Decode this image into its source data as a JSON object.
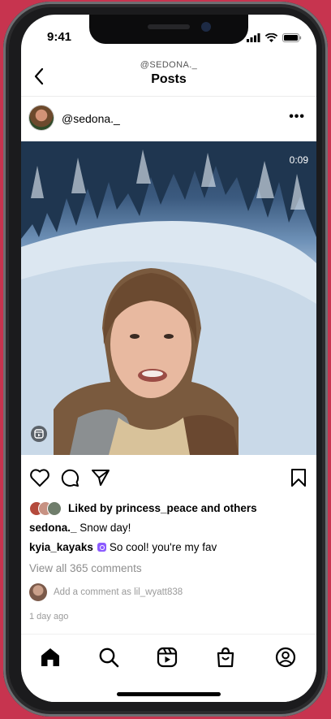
{
  "status_bar": {
    "time": "9:41"
  },
  "header": {
    "handle": "@SEDONA._",
    "title": "Posts"
  },
  "post": {
    "username": "@sedona._",
    "video_duration": "0:09",
    "liked_by": "Liked by princess_peace and others",
    "caption": {
      "user": "sedona._",
      "text": "Snow day!"
    },
    "comment": {
      "user": "kyia_kayaks",
      "text": "So cool! you're my fav"
    },
    "view_all_comments": "View all 365 comments",
    "add_comment_placeholder": "Add a comment as lil_wyatt838",
    "time_ago": "1 day ago"
  },
  "icons": {
    "back": "chevron-left-icon",
    "more": "more-horizontal-icon",
    "like": "heart-icon",
    "comment": "comment-icon",
    "share": "send-icon",
    "save": "bookmark-icon",
    "reel": "reel-icon",
    "tabs": [
      "home-icon",
      "search-icon",
      "reels-icon",
      "shop-icon",
      "profile-icon"
    ]
  },
  "colors": {
    "background": "#c7344f",
    "comment_badge": "#8c5bff",
    "muted_text": "#8e8e8e"
  }
}
